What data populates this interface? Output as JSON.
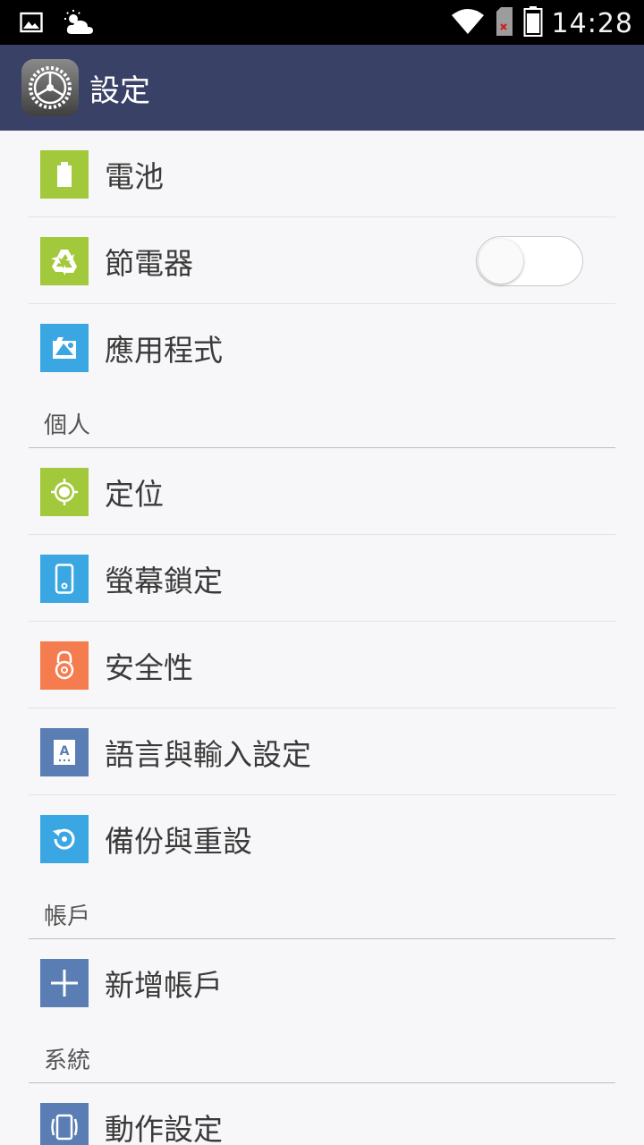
{
  "status_bar": {
    "time": "14:28",
    "icons": [
      "image-icon",
      "weather-icon",
      "wifi-icon",
      "sim-missing-icon",
      "battery-icon"
    ]
  },
  "app_bar": {
    "title": "設定",
    "icon": "settings-gear-icon"
  },
  "colors": {
    "app_bar": "#3a4166",
    "green": "#a2c83c",
    "blue": "#3aa7e3",
    "orange": "#f57c4e",
    "slate": "#5a7db3"
  },
  "items": {
    "battery": {
      "label": "電池",
      "icon": "battery-icon"
    },
    "power_saver": {
      "label": "節電器",
      "icon": "recycle-icon",
      "toggle_on": false
    },
    "apps": {
      "label": "應用程式",
      "icon": "apps-icon"
    },
    "personal": {
      "title": "個人"
    },
    "location": {
      "label": "定位",
      "icon": "location-icon"
    },
    "screen_lock": {
      "label": "螢幕鎖定",
      "icon": "phone-lock-icon"
    },
    "security": {
      "label": "安全性",
      "icon": "lock-icon"
    },
    "language": {
      "label": "語言與輸入設定",
      "icon": "language-icon"
    },
    "backup": {
      "label": "備份與重設",
      "icon": "backup-icon"
    },
    "accounts": {
      "title": "帳戶"
    },
    "add_account": {
      "label": "新增帳戶",
      "icon": "plus-icon"
    },
    "system": {
      "title": "系統"
    },
    "motion": {
      "label": "動作設定",
      "icon": "motion-icon"
    }
  }
}
